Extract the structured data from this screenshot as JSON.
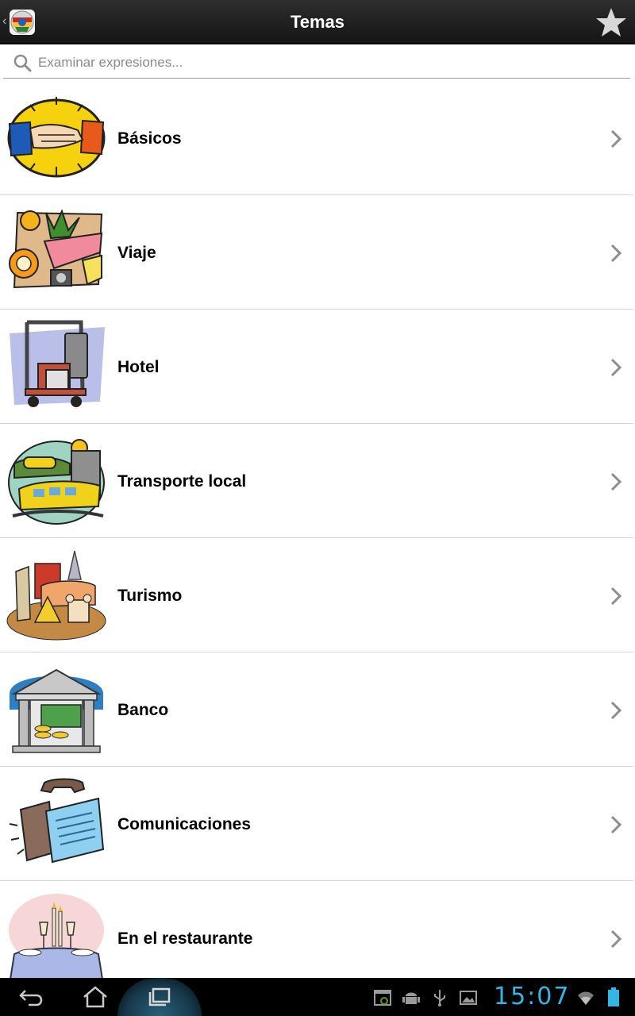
{
  "action_bar": {
    "title": "Temas",
    "app_icon": "flags-globe-icon",
    "favorite_icon": "star-icon"
  },
  "search": {
    "placeholder": "Examinar expresiones...",
    "value": ""
  },
  "topics": [
    {
      "label": "Básicos",
      "icon": "handshake-icon"
    },
    {
      "label": "Viaje",
      "icon": "travel-items-icon"
    },
    {
      "label": "Hotel",
      "icon": "luggage-cart-icon"
    },
    {
      "label": "Transporte local",
      "icon": "train-bus-icon"
    },
    {
      "label": "Turismo",
      "icon": "landmarks-icon"
    },
    {
      "label": "Banco",
      "icon": "bank-building-icon"
    },
    {
      "label": "Comunicaciones",
      "icon": "telephone-fax-icon"
    },
    {
      "label": "En el restaurante",
      "icon": "dinner-table-icon"
    }
  ],
  "system_bar": {
    "time": "15:07",
    "nav_icons": [
      "back-icon",
      "home-icon",
      "recents-icon"
    ],
    "notification_icons": [
      "screenshot-icon",
      "android-debug-icon",
      "usb-icon",
      "gallery-icon"
    ],
    "status_icons": [
      "wifi-icon",
      "battery-icon"
    ]
  },
  "colors": {
    "action_bar": "#1c1c1c",
    "clock": "#33b5e5",
    "divider": "#d6d6d6"
  }
}
